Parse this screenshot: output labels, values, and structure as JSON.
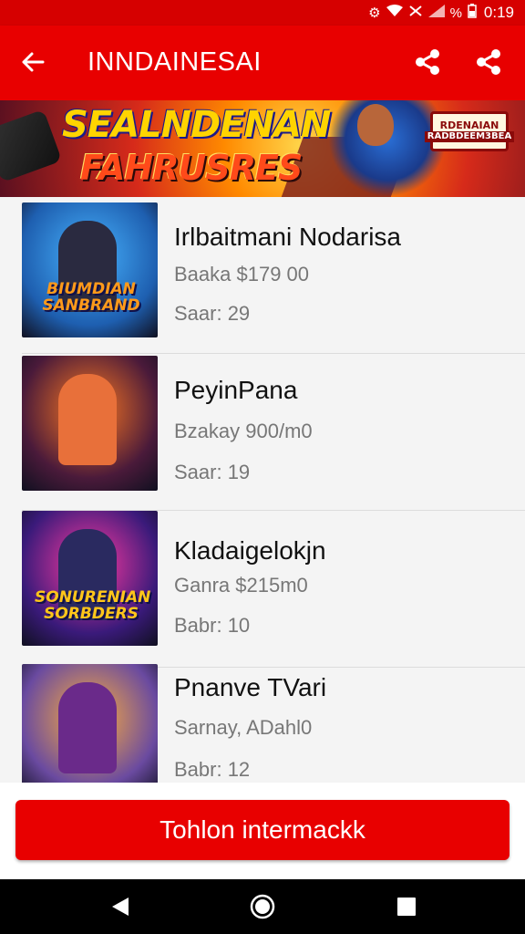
{
  "status_bar": {
    "battery_text": "%",
    "time": "0:19"
  },
  "app_bar": {
    "title": "INNDAINESAI"
  },
  "banner": {
    "title_line1": "SEALNDENAN",
    "title_line2": "FAHRUSRES",
    "badge_line1": "RDENAIAN",
    "badge_line2": "RADBDEEM3BEA"
  },
  "items": [
    {
      "title": "Irlbaitmani Nodarisa",
      "price": "Baaka $179 00",
      "stock": "Saar: 29",
      "thumb_caption": "BIUMDIAN SANBRAND",
      "colors": {
        "bg": "#1e5fb0",
        "accent": "#48b4ff",
        "char": "#2a2a40",
        "caption": "#ff9a1a"
      }
    },
    {
      "title": "PeyinPana",
      "price": "Bzakay 900/m0",
      "stock": "Saar: 19",
      "thumb_caption": "",
      "colors": {
        "bg": "#4a1a3a",
        "accent": "#ff7a20",
        "char": "#e8703a",
        "caption": "#ffc61a"
      }
    },
    {
      "title": "Kladaigelokjn",
      "price": "Ganra $215m0",
      "stock": "Babr: 10",
      "thumb_caption": "SONURENIAN SORBDERS",
      "colors": {
        "bg": "#3a1a7a",
        "accent": "#ff3aa0",
        "char": "#2a2a60",
        "caption": "#ffc61a"
      }
    },
    {
      "title": "Pnanve TVari",
      "price": "Sarnay, ADahl0",
      "stock": "Babr: 12",
      "thumb_caption": "",
      "colors": {
        "bg": "#6a4aa0",
        "accent": "#ffb03a",
        "char": "#6a2a8a",
        "caption": "#ffffff"
      }
    }
  ],
  "cta": {
    "label": "Tohlon intermackk"
  },
  "theme": {
    "primary": "#e80000",
    "status_bar": "#d60000"
  }
}
